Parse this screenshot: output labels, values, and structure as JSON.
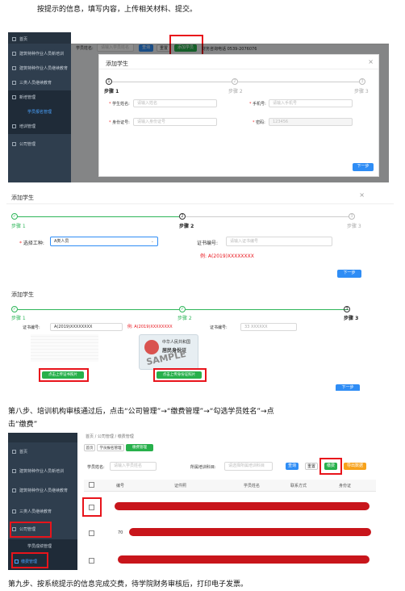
{
  "intro_text": "按提示的信息，填写内容，上传相关材料、提交。",
  "step8_text_line1": "第八步、培训机构审核通过后，点击“公司管理”→“缴费管理”→“勾选学员姓名”→点",
  "step8_text_line2": "击“缴费”",
  "step9_text": "第九步、按系统提示的信息完成交费，待学院财务审核后，打印电子发票。",
  "shot1": {
    "sidebar_items": [
      "首页",
      "建筑特种作业人员新培训",
      "建筑特种作业人员继续教育",
      "三类人员继续教育",
      "新培管理",
      "学员报名管理",
      "培训管理",
      "公司管理"
    ],
    "top_search_label": "学员姓名:",
    "top_placeholder": "请输入学员姓名",
    "top_btn_search": "查询",
    "top_btn_reset": "重置",
    "top_btn_add": "添加学员",
    "top_phone_text": "财务咨询电话 0539-2076076",
    "modal_title": "添加学生",
    "steps": [
      "步骤 1",
      "步骤 2",
      "步骤 3"
    ],
    "step_nums": [
      "1",
      "2",
      "3"
    ],
    "f_name_label": "学生姓名:",
    "f_name_ph": "请输入姓名",
    "f_phone_label": "手机号:",
    "f_phone_ph": "请输入手机号",
    "f_id_label": "身份证号:",
    "f_id_ph": "请输入身份证号",
    "f_pwd_label": "密码:",
    "f_pwd_val": "123456",
    "next_btn": "下一步"
  },
  "shot2": {
    "title": "添加学生",
    "steps": [
      "步骤 1",
      "步骤 2",
      "步骤 3"
    ],
    "step_nums": [
      "✓",
      "2",
      "3"
    ],
    "worktype_label": "选择工种:",
    "worktype_val": "A类人员",
    "cert_label": "证书编号:",
    "cert_ph": "请输入证书编号",
    "example": "例: A(2019)XXXXXXXX",
    "next_btn": "下一步"
  },
  "shot3": {
    "title": "添加学生",
    "steps": [
      "步骤 1",
      "步骤 2",
      "步骤 3"
    ],
    "step_nums": [
      "✓",
      "✓",
      "3"
    ],
    "cert_label": "证书编号:",
    "cert_val": "A(2019)XXXXXXXX",
    "example": "例: A(2019)XXXXXXXX",
    "cert_label2": "证书编号:",
    "cert_val2": "33 XXXXXX",
    "idcard_title": "中华人民共和国",
    "idcard_sub": "居民身份证",
    "sample": "SAMPLE",
    "upload_cert_btn": "点击上传证书照片",
    "upload_id_btn": "点击上传身份证照片",
    "next_btn": "下一步"
  },
  "shot4": {
    "sidebar_items": [
      "首页",
      "建筑特种作业人员新培训",
      "建筑特种作业人员继续教育",
      "三类人员继续教育",
      "公司管理",
      "学员成绩管理",
      "缴费管理"
    ],
    "breadcrumb": "首页 / 公司管理 / 缴费管理",
    "tabs": [
      "首页",
      "学员报名管理",
      "缴费管理"
    ],
    "search_label": "学员姓名:",
    "search_ph": "请输入学员姓名",
    "subject_label": "所属培训科目:",
    "subject_ph": "请选择所属培训科目",
    "btn_search": "查询",
    "btn_reset": "重置",
    "btn_pay": "缴费",
    "btn_export": "导出数据",
    "columns": [
      "编号",
      "证件照",
      "学员姓名",
      "联系方式",
      "身份证"
    ],
    "row_num2": "70"
  }
}
